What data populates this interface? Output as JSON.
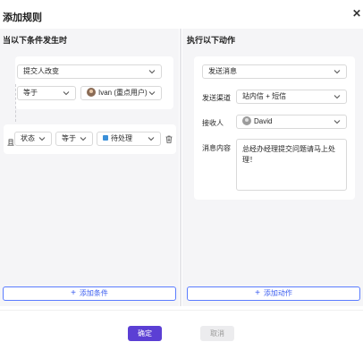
{
  "dialog": {
    "title": "添加规则",
    "close_icon": "close-icon"
  },
  "left": {
    "title": "当以下条件发生时",
    "trigger": {
      "value": "提交人改变"
    },
    "operator": {
      "value": "等于"
    },
    "person": {
      "value": "Ivan (重点用户)",
      "icon": "avatar"
    },
    "condition": {
      "prefix": "且",
      "field": "状态",
      "operator": "等于",
      "value": "待处理",
      "value_color": "#3b8fd8",
      "delete_icon": "trash-icon"
    },
    "add_button": "添加条件"
  },
  "right": {
    "title": "执行以下动作",
    "action": {
      "value": "发送消息"
    },
    "channel": {
      "label": "发送渠道",
      "value": "站内信 + 短信"
    },
    "recipient": {
      "label": "接收人",
      "value": "David",
      "icon": "avatar"
    },
    "message": {
      "label": "消息内容",
      "value": "总经办经理提交问题请马上处理！"
    },
    "add_button": "添加动作"
  },
  "footer": {
    "confirm": "确定",
    "cancel": "取消"
  },
  "colors": {
    "primary": "#5b3fd4",
    "link": "#3d5ff0",
    "panel_bg": "#f5f5f7"
  }
}
